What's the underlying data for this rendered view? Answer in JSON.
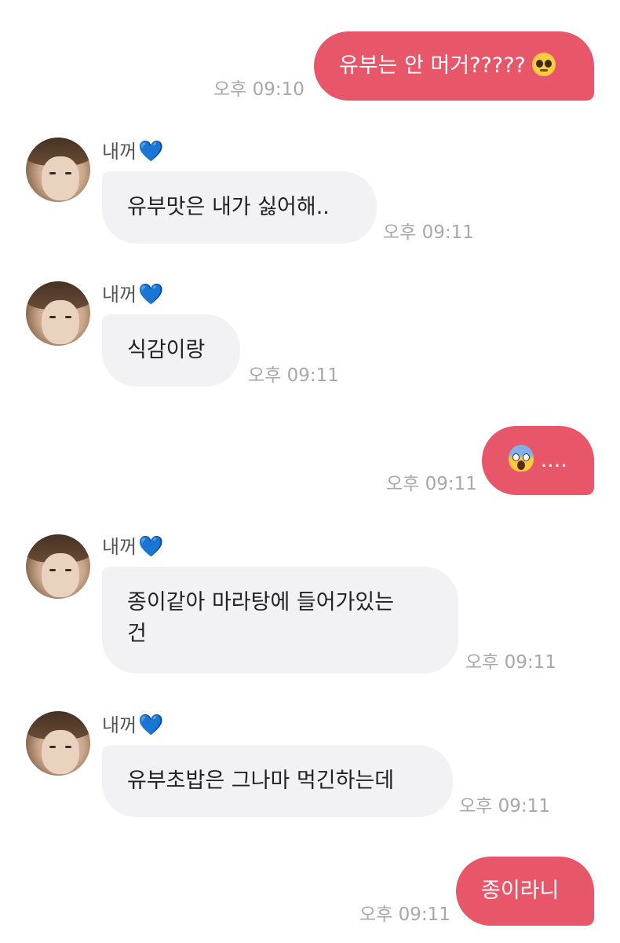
{
  "contact": {
    "name": "내꺼",
    "heart": "💙"
  },
  "messages": [
    {
      "from": "me",
      "text": "유부는 안 머거?????",
      "emoji": "pleading-face",
      "time": "오후 09:10"
    },
    {
      "from": "them",
      "text": "유부맛은 내가 싫어해..",
      "time": "오후 09:11"
    },
    {
      "from": "them",
      "text": "식감이랑",
      "time": "오후 09:11"
    },
    {
      "from": "me",
      "emoji": "screaming-face",
      "text": "....",
      "time": "오후 09:11"
    },
    {
      "from": "them",
      "text_line1": "종이같아 마라탕에 들어가있는",
      "text_line2": "건",
      "time": "오후 09:11"
    },
    {
      "from": "them",
      "text": "유부초밥은 그나마 먹긴하는데",
      "time": "오후 09:11"
    },
    {
      "from": "me",
      "text": "종이라니",
      "time": "오후 09:11"
    }
  ],
  "colors": {
    "outgoing_bubble": "#e8566a",
    "incoming_bubble": "#f2f2f5",
    "timestamp": "#a7a7ad",
    "heart": "#2a72e8"
  }
}
